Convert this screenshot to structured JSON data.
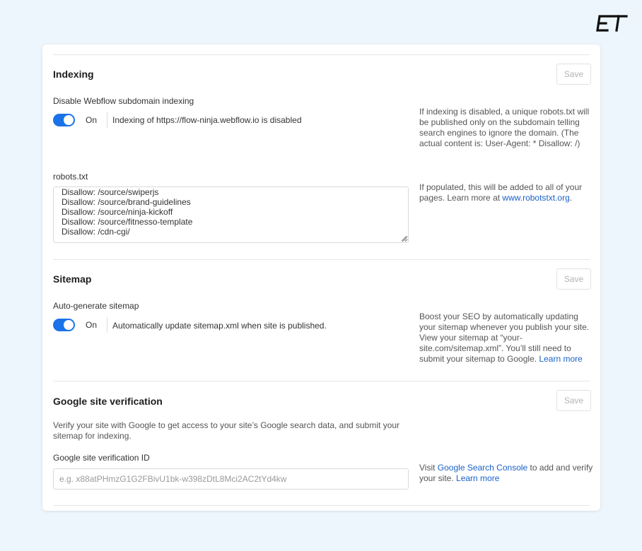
{
  "brand": {
    "logo_text": "ET"
  },
  "indexing": {
    "title": "Indexing",
    "save_label": "Save",
    "toggle_label": "Disable Webflow subdomain indexing",
    "toggle_state": "On",
    "toggle_description": "Indexing of https://flow-ninja.webflow.io is disabled",
    "help_text": "If indexing is disabled, a unique robots.txt will be published only on the subdomain telling search engines to ignore the domain. (The actual content is: User-Agent: * Disallow: /)",
    "robots_label": "robots.txt",
    "robots_lines": [
      "Disallow: /source/swiperjs",
      "Disallow: /source/brand-guidelines",
      "Disallow: /source/ninja-kickoff",
      "Disallow: /source/fitnesso-template",
      "Disallow: /cdn-cgi/"
    ],
    "robots_help_prefix": "If populated, this will be added to all of your pages. Learn more at ",
    "robots_help_link": "www.robotstxt.org",
    "robots_help_suffix": "."
  },
  "sitemap": {
    "title": "Sitemap",
    "save_label": "Save",
    "toggle_label": "Auto-generate sitemap",
    "toggle_state": "On",
    "toggle_description": "Automatically update sitemap.xml when site is published.",
    "help_text": "Boost your SEO by automatically updating your sitemap whenever you publish your site. View your sitemap at “your-site.com/sitemap.xml”. You’ll still need to submit your sitemap to Google. ",
    "help_link": "Learn more"
  },
  "google": {
    "title": "Google site verification",
    "save_label": "Save",
    "description": "Verify your site with Google to get access to your site’s Google search data, and submit your sitemap for indexing.",
    "field_label": "Google site verification ID",
    "field_value": "",
    "field_placeholder": "e.g. x88atPHmzG1G2FBivU1bk-w398zDtL8Mci2AC2tYd4kw",
    "help_prefix": "Visit ",
    "help_link1": "Google Search Console",
    "help_middle": " to add and verify your site. ",
    "help_link2": "Learn more"
  },
  "colors": {
    "accent": "#1a73e8",
    "link": "#1a61c8",
    "background": "#eef6fd"
  }
}
